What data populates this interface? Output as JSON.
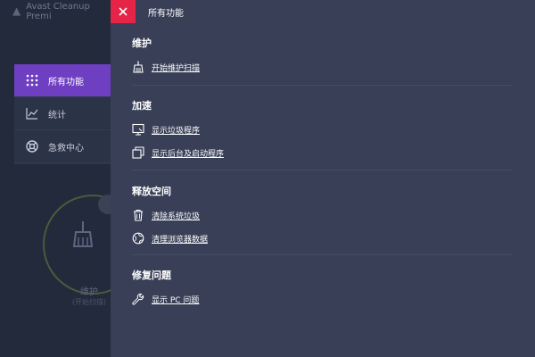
{
  "window": {
    "app_title": "Avast Cleanup Premi"
  },
  "background": {
    "sidebar": [
      {
        "label": "所有功能",
        "icon": "grid-icon",
        "active": true
      },
      {
        "label": "统计",
        "icon": "chart-icon",
        "active": false
      },
      {
        "label": "急救中心",
        "icon": "lifebuoy-icon",
        "active": false
      }
    ],
    "maintenance_label": "维护",
    "maintenance_sub": "(开始扫描)"
  },
  "panel": {
    "title": "所有功能",
    "close_icon": "close-icon",
    "accent_color": "#e62447",
    "sections": [
      {
        "title": "维护",
        "items": [
          {
            "label": "开始维护扫描",
            "icon": "broom-icon"
          }
        ]
      },
      {
        "title": "加速",
        "items": [
          {
            "label": "显示垃圾程序",
            "icon": "monitor-icon"
          },
          {
            "label": "显示后台及启动程序",
            "icon": "windows-icon"
          }
        ]
      },
      {
        "title": "释放空间",
        "items": [
          {
            "label": "清除系统垃圾",
            "icon": "trash-icon"
          },
          {
            "label": "清理浏览器数据",
            "icon": "globe-icon"
          }
        ]
      },
      {
        "title": "修复问题",
        "items": [
          {
            "label": "显示 PC 问题",
            "icon": "wrench-icon"
          }
        ]
      }
    ]
  }
}
